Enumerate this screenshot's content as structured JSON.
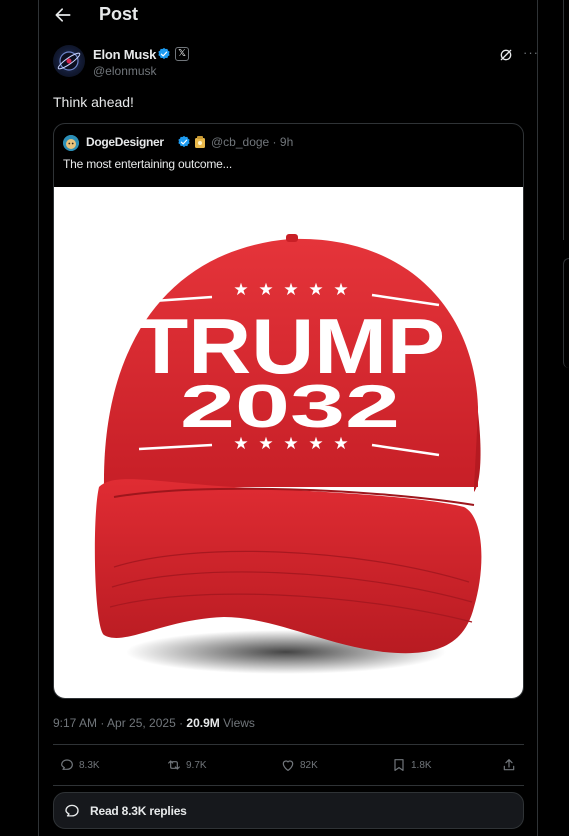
{
  "header": {
    "title": "Post"
  },
  "post": {
    "author_name": "Elon Musk",
    "author_handle": "@elonmusk",
    "affiliate_badge": "𝕏",
    "text": "Think ahead!",
    "timestamp": "9:17 AM · Apr 25, 2025 · ",
    "views_count": "20.9M",
    "views_label": " Views"
  },
  "quote": {
    "author_name": "DogeDesigner",
    "author_handle": "@cb_doge · 9h",
    "text": "The most entertaining outcome...",
    "image": {
      "line1": "TRUMP",
      "line2": "2032"
    }
  },
  "actions": {
    "replies": "8.3K",
    "reposts": "9.7K",
    "likes": "82K",
    "bookmarks": "1.8K"
  },
  "read_replies": {
    "label": "Read 8.3K replies"
  },
  "colors": {
    "background": "#000000",
    "border": "#2f3336",
    "text": "#e7e9ea",
    "muted": "#71767b",
    "verified": "#1d9bf0",
    "hat_red": "#d9262b"
  },
  "icons": [
    "back-arrow-icon",
    "verified-badge-icon",
    "grok-icon",
    "more-icon",
    "reply-icon",
    "repost-icon",
    "like-icon",
    "bookmark-icon",
    "share-icon",
    "replies-bubble-icon"
  ]
}
